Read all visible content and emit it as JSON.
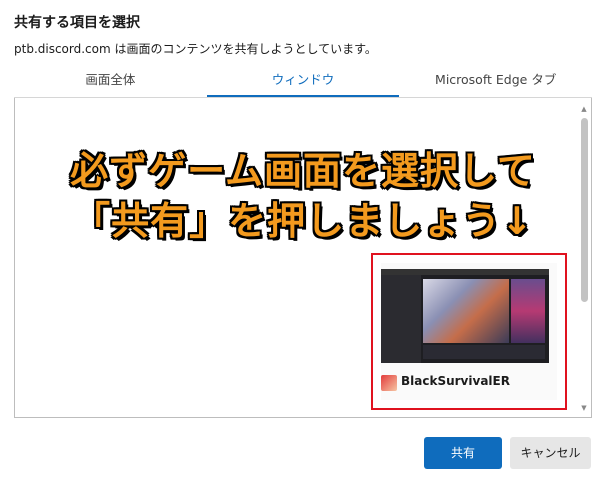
{
  "dialog": {
    "title": "共有する項目を選択",
    "subtitle": "ptb.discord.com は画面のコンテンツを共有しようとしています。"
  },
  "tabs": [
    {
      "label": "画面全体",
      "active": false
    },
    {
      "label": "ウィンドウ",
      "active": true
    },
    {
      "label": "Microsoft Edge タブ",
      "active": false
    }
  ],
  "overlay": {
    "line1": "必ずゲーム画面を選択して",
    "line2": "「共有」を押しましょう↓"
  },
  "windows": [
    {
      "label": "BlackSurvivalER",
      "selected": true
    }
  ],
  "buttons": {
    "share": "共有",
    "cancel": "キャンセル"
  },
  "colors": {
    "accent": "#0f6cbd",
    "highlight": "#e0121f",
    "overlay_text": "#f39a1e"
  }
}
